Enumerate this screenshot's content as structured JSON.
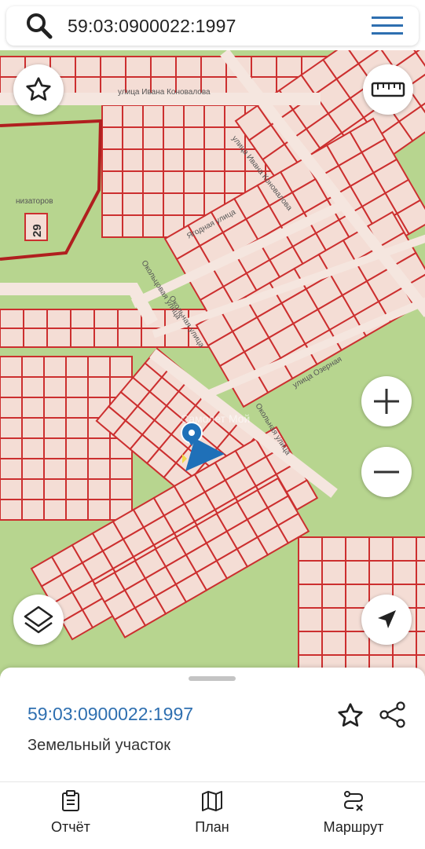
{
  "search": {
    "query": "59:03:0900022:1997"
  },
  "map": {
    "street_labels": [
      "улица Ивана Коновалова",
      "улица Ивана Коновалова",
      "Ягодная улица",
      "Окольцовая улица",
      "Окольная улица",
      "Окольная улица",
      "улица Озерная",
      "низаторов"
    ],
    "house_number": "29",
    "watermark": "Самолет Мой",
    "colors": {
      "parcel_border": "#cc2f2f",
      "parcel_fill": "#f4ddd5",
      "vegetation": "#b7d58f",
      "marker": "#1f70b8"
    }
  },
  "buttons": {
    "favorite_icon": "star-outline-icon",
    "ruler_icon": "ruler-icon",
    "zoom_in_icon": "plus-icon",
    "zoom_out_icon": "minus-icon",
    "layers_icon": "layers-icon",
    "locate_icon": "navigation-arrow-icon"
  },
  "sheet": {
    "object_id": "59:03:0900022:1997",
    "object_type": "Земельный участок"
  },
  "tabs": [
    {
      "label": "Отчёт",
      "icon": "report-clipboard-icon"
    },
    {
      "label": "План",
      "icon": "map-plan-icon"
    },
    {
      "label": "Маршрут",
      "icon": "route-icon"
    }
  ]
}
